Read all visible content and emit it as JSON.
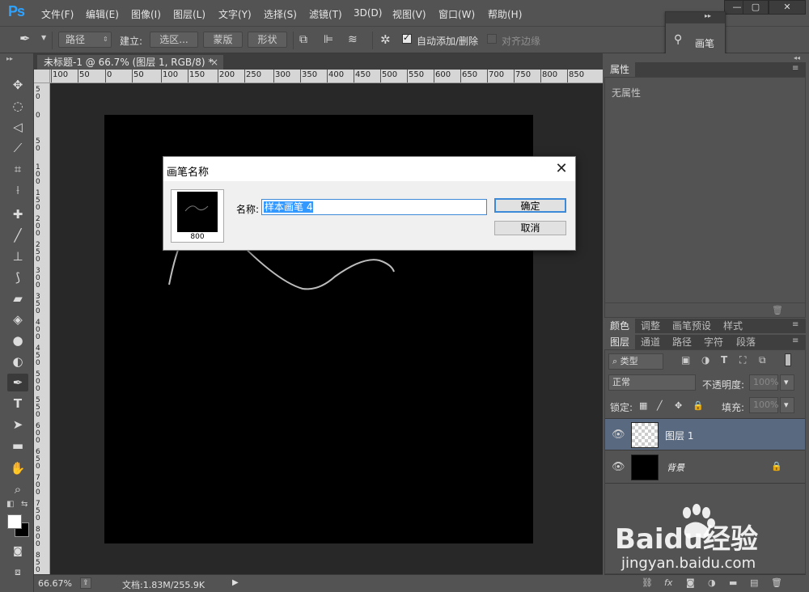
{
  "app": {
    "logo": "Ps"
  },
  "menu": [
    "文件(F)",
    "编辑(E)",
    "图像(I)",
    "图层(L)",
    "文字(Y)",
    "选择(S)",
    "滤镜(T)",
    "3D(D)",
    "视图(V)",
    "窗口(W)",
    "帮助(H)"
  ],
  "window_controls": {
    "minimize": "—",
    "maximize": "▢",
    "close": "✕"
  },
  "options_bar": {
    "mode_select": "路径",
    "make_label": "建立:",
    "btn_selection": "选区...",
    "btn_mask": "蒙版",
    "btn_shape": "形状",
    "auto_add_delete": "自动添加/删除",
    "align_edges": "对齐边缘"
  },
  "brush_panel": {
    "label": "画笔",
    "collapse": "▸▸"
  },
  "document": {
    "tab_title": "未标题-1 @ 66.7% (图层 1, RGB/8) *",
    "tab_close": "×",
    "zoom": "66.67%",
    "doc_info": "文档:1.83M/255.9K"
  },
  "ruler_top_labels": [
    "100",
    "50",
    "0",
    "50",
    "100",
    "150",
    "200",
    "250",
    "300",
    "350",
    "400",
    "450",
    "500",
    "550",
    "600",
    "650",
    "700",
    "750",
    "800",
    "850"
  ],
  "ruler_left_labels": [
    "5 0",
    "0",
    "5 0",
    "1 0 0",
    "1 5 0",
    "2 0 0",
    "2 5 0",
    "3 0 0",
    "3 5 0",
    "4 0 0",
    "4 5 0",
    "5 0 0",
    "5 5 0",
    "6 0 0",
    "6 5 0",
    "7 0 0",
    "7 5 0",
    "8 0 0",
    "8 5 0"
  ],
  "properties_panel": {
    "tab": "属性",
    "empty_text": "无属性"
  },
  "color_tabs": [
    "颜色",
    "调整",
    "画笔预设",
    "样式"
  ],
  "layer_tabs": [
    "图层",
    "通道",
    "路径",
    "字符",
    "段落"
  ],
  "layers_panel": {
    "filter_kind": "类型",
    "blend_mode": "正常",
    "opacity_label": "不透明度:",
    "opacity_value": "100%",
    "lock_label": "锁定:",
    "fill_label": "填充:",
    "fill_value": "100%",
    "layers": [
      {
        "name": "图层 1",
        "selected": true,
        "locked": false
      },
      {
        "name": "背景",
        "selected": false,
        "locked": true
      }
    ]
  },
  "dialog": {
    "title": "画笔名称",
    "close": "✕",
    "name_label": "名称:",
    "name_value": "样本画笔 4",
    "brush_size": "800",
    "ok": "确定",
    "cancel": "取消"
  },
  "watermark": {
    "brand": "Baidu经验",
    "url": "jingyan.baidu.com"
  },
  "colors": {
    "ps_blue": "#2ea2ff",
    "selected_layer": "#596a80",
    "dialog_accent": "#3c8ad8"
  }
}
